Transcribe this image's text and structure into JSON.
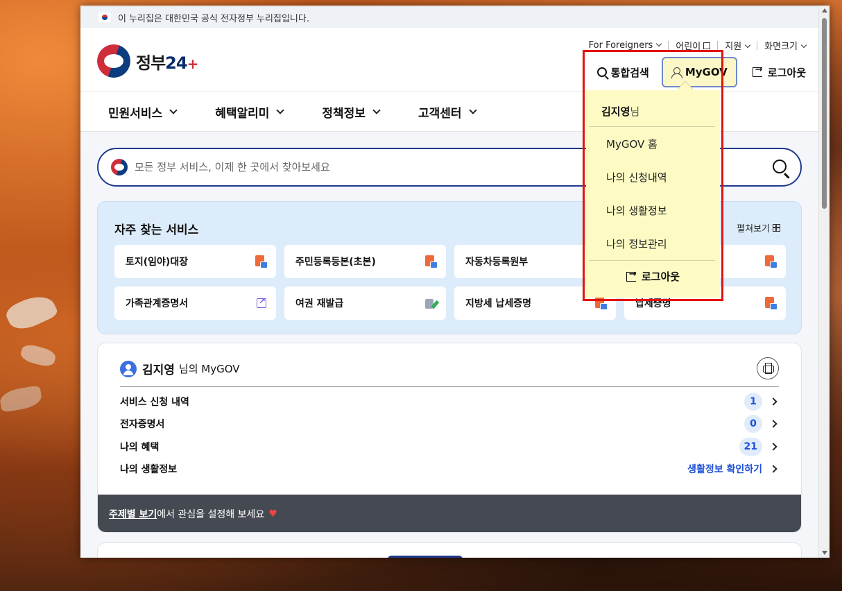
{
  "banner": {
    "text": "이 누리집은 대한민국 공식 전자정부 누리집입니다."
  },
  "logo": {
    "text_main": "정부",
    "text_num": "24",
    "text_plus": "+"
  },
  "util_links": [
    {
      "label": "For Foreigners"
    },
    {
      "label": "어린이"
    },
    {
      "label": "지원"
    },
    {
      "label": "화면크기"
    }
  ],
  "actions": {
    "search_label": "통합검색",
    "mygov_label": "MyGOV",
    "logout_label": "로그아웃"
  },
  "nav": [
    {
      "label": "민원서비스"
    },
    {
      "label": "혜택알리미"
    },
    {
      "label": "정책정보"
    },
    {
      "label": "고객센터"
    }
  ],
  "search": {
    "placeholder": "모든 정부 서비스, 이제 한 곳에서 찾아보세요"
  },
  "frequent": {
    "title": "자주 찾는 서비스",
    "expand_label": "펼쳐보기",
    "items": [
      {
        "label": "토지(임야)대장",
        "icon": "pdf-icon"
      },
      {
        "label": "주민등록등본(초본)",
        "icon": "pdf-icon"
      },
      {
        "label": "자동차등록원부",
        "icon": "pdf-icon"
      },
      {
        "label": "",
        "icon": "pdf-icon"
      },
      {
        "label": "가족관계증명서",
        "icon": "external-link-icon"
      },
      {
        "label": "여권 재발급",
        "icon": "edit-icon"
      },
      {
        "label": "지방세 납세증명",
        "icon": "pdf-icon"
      },
      {
        "label": "납세증명",
        "icon": "pdf-icon"
      }
    ]
  },
  "mygov_card": {
    "user_name": "김지영",
    "title_suffix": "님의 MyGOV",
    "rows": [
      {
        "label": "서비스 신청 내역",
        "count": "1"
      },
      {
        "label": "전자증명서",
        "count": "0"
      },
      {
        "label": "나의 혜택",
        "count": "21"
      },
      {
        "label": "나의 생활정보",
        "link": "생활정보 확인하기"
      }
    ],
    "theme_link": "주제별 보기",
    "theme_text": "에서 관심을 설정해 보세요"
  },
  "dropdown": {
    "user_name": "김지영",
    "user_suffix": "님",
    "items": [
      {
        "label": "MyGOV 홈"
      },
      {
        "label": "나의 신청내역"
      },
      {
        "label": "나의 생활정보"
      },
      {
        "label": "나의 정보관리"
      }
    ],
    "logout_label": "로그아웃"
  },
  "colors": {
    "accent": "#1e3a8a",
    "count_blue": "#1d4fd8",
    "dropdown_bg": "#fdfbc3",
    "highlight_outline": "#e3120b"
  }
}
